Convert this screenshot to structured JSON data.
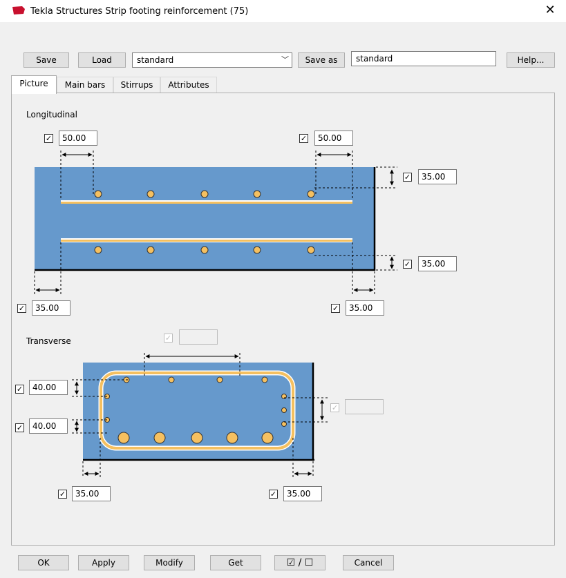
{
  "window": {
    "title": "Tekla Structures  Strip footing reinforcement (75)",
    "close_glyph": "✕"
  },
  "toolbar": {
    "save_label": "Save",
    "load_label": "Load",
    "preset_value": "standard",
    "save_as_label": "Save as",
    "save_as_value": "standard",
    "help_label": "Help..."
  },
  "tabs": [
    "Picture",
    "Main bars",
    "Stirrups",
    "Attributes"
  ],
  "longitudinal": {
    "label": "Longitudinal",
    "top_left_value": "50.00",
    "top_right_value": "50.00",
    "right_top_value": "35.00",
    "right_bottom_value": "35.00",
    "bottom_left_value": "35.00",
    "bottom_right_value": "35.00"
  },
  "transverse": {
    "label": "Transverse",
    "top_value": "",
    "left_top_value": "40.00",
    "left_bottom_value": "40.00",
    "right_value": "",
    "bottom_left_value": "35.00",
    "bottom_right_value": "35.00"
  },
  "footer": {
    "ok_label": "OK",
    "apply_label": "Apply",
    "modify_label": "Modify",
    "get_label": "Get",
    "toggle_glyph": "☑ / ☐",
    "cancel_label": "Cancel"
  },
  "colors": {
    "concrete": "#6699cc",
    "rebar": "#f5c060"
  },
  "checkbox_mark": "✓"
}
